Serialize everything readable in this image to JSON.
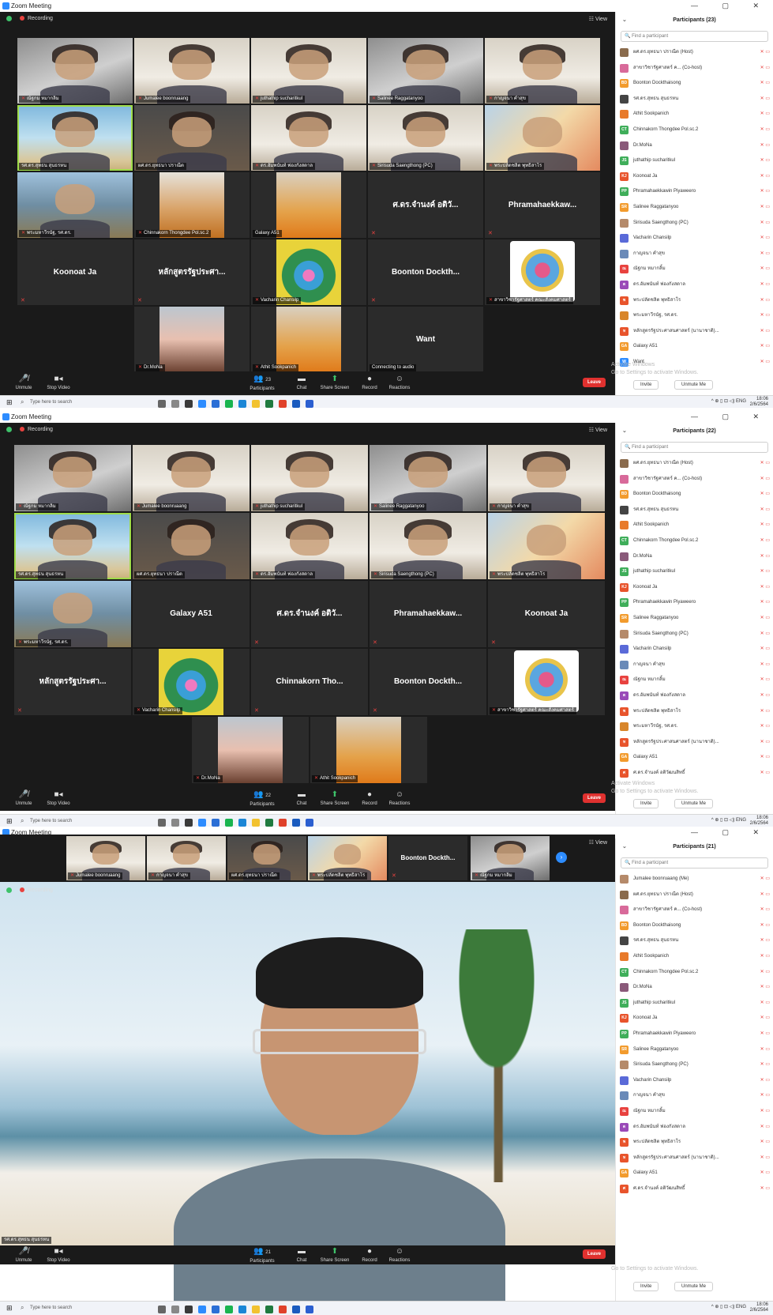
{
  "app_title": "Zoom Meeting",
  "window_controls": [
    "—",
    "▢",
    "✕"
  ],
  "recording_label": "Recording",
  "view_label": "View",
  "colors": {
    "accent": "#2d8cff",
    "leave": "#e0312f",
    "active_speaker": "#9fdc4a",
    "mic_muted": "#e8423f"
  },
  "toolbar": {
    "unmute": "Unmute",
    "stop_video": "Stop Video",
    "participants": "Participants",
    "chat": "Chat",
    "share_screen": "Share Screen",
    "record": "Record",
    "reactions": "Reactions",
    "leave": "Leave"
  },
  "taskbar": {
    "search_placeholder": "Type here to search",
    "lang": "ENG",
    "time": "18:06",
    "date": "2/6/2564"
  },
  "panel_common": {
    "search_placeholder": "Find a participant",
    "invite": "Invite",
    "unmute_me": "Unmute Me",
    "watermark_1": "Activate Windows",
    "watermark_2": "Go to Settings to activate Windows."
  },
  "shot1": {
    "participants_count_badge": "23",
    "panel_title": "Participants (23)",
    "tiles_row1": [
      "ณัฐกม หมากลิ้ม",
      "Jumalee boonruaang",
      "juthathip sucharitkul",
      "Salinee Raggatanyoo",
      "กาญจนา คำสุข"
    ],
    "tiles_row2": [
      "รศ.ดร.สุทธน สุนธรหน",
      "ผศ.ดร.ยุทธนา ปราณีต",
      "ดร.อัมพนันท์ ฟองกังสดาล",
      "Sirisuda Saengthong (PC)",
      "พระปลัดชลิต พุทธิสาโร"
    ],
    "tiles_row3": [
      "พระมหาวีรนัฐ, รศ.ดร.",
      "Chinnakorn Thongdee Pol.sc.2",
      "Galaxy A51",
      "ศ.ดร.จำนงค์ อติวั...",
      "Phramahaekkaw..."
    ],
    "tiles_row4": [
      "Koonoat Ja",
      "หลักสูตรรัฐประศา...",
      "Vacharin Chansilp",
      "Boonton Dockth...",
      "สาขาวิชารัฐศาสตร์ คณะสังคมศาสตร์"
    ],
    "tiles_row5": [
      "Dr.MoNa",
      "Athit Sookpanich",
      "Want"
    ],
    "connecting": "Connecting to audio",
    "participants": [
      {
        "name": "ผศ.ดร.ยุทธนา ปราณีต (Host)",
        "av": "",
        "c": "#8a6b4d"
      },
      {
        "name": "สาขาวิชารัฐศาสตร์ ค... (Co-host)",
        "av": "",
        "c": "#d86a9a"
      },
      {
        "name": "Boonton Dockthaisong",
        "av": "BD",
        "c": "#f29b2d"
      },
      {
        "name": "รศ.ดร.สุทธน สุนธรหน",
        "av": "",
        "c": "#444"
      },
      {
        "name": "Athit Sookpanich",
        "av": "",
        "c": "#e87a2a"
      },
      {
        "name": "Chinnakorn Thongdee Pol.sc.2",
        "av": "CT",
        "c": "#3fae5a"
      },
      {
        "name": "Dr.MoNa",
        "av": "",
        "c": "#8a5a7a"
      },
      {
        "name": "juthathip sucharitkul",
        "av": "JS",
        "c": "#3fae5a"
      },
      {
        "name": "Koonoat Ja",
        "av": "KJ",
        "c": "#e8542c"
      },
      {
        "name": "Phramahaekkawin Piyaweero",
        "av": "PP",
        "c": "#3fae5a"
      },
      {
        "name": "Salinee Raggatanyoo",
        "av": "SR",
        "c": "#f29b2d"
      },
      {
        "name": "Sirisuda Saengthong (PC)",
        "av": "",
        "c": "#b58a6a"
      },
      {
        "name": "Vacharin Chansilp",
        "av": "",
        "c": "#5a6ad8"
      },
      {
        "name": "กาญจนา คำสุข",
        "av": "",
        "c": "#6a8ab8"
      },
      {
        "name": "ณัฐกม หมากลิ้ม",
        "av": "ณ",
        "c": "#e8423f"
      },
      {
        "name": "ดร.อัมพนันท์ ฟองกังสดาล",
        "av": "ด",
        "c": "#9a4ab8"
      },
      {
        "name": "พระปลัดชลิต พุทธิสาโร",
        "av": "พ",
        "c": "#e8542c"
      },
      {
        "name": "พระมหาวีรนัฐ, รศ.ดร.",
        "av": "",
        "c": "#d8862a"
      },
      {
        "name": "หลักสูตรรัฐประศาสนศาสตร์ (นานาชาติ)...",
        "av": "ห",
        "c": "#e8542c"
      },
      {
        "name": "Galaxy A51",
        "av": "GA",
        "c": "#f29b2d"
      },
      {
        "name": "Want",
        "av": "W",
        "c": "#2d8cff"
      }
    ]
  },
  "shot2": {
    "participants_count_badge": "22",
    "panel_title": "Participants (22)",
    "tiles_row1": [
      "ณัฐกม หมากลิ้ม",
      "Jumalee boonruaang",
      "juthathip sucharitkul",
      "Salinee Raggatanyoo",
      "กาญจนา คำสุข"
    ],
    "tiles_row2": [
      "รศ.ดร.สุทธน สุนธรหน",
      "ผศ.ดร.ยุทธนา ปราณีต",
      "ดร.อัมพนันท์ ฟองกังสดาล",
      "Sirisuda Saengthong (PC)",
      "พระปลัดชลิต พุทธิสาโร"
    ],
    "tiles_row3": [
      "พระมหาวีรนัฐ, รศ.ดร.",
      "Galaxy A51",
      "ศ.ดร.จำนงค์ อติวั...",
      "Phramahaekkaw...",
      "Koonoat Ja"
    ],
    "tiles_row4": [
      "หลักสูตรรัฐประศา...",
      "Vacharin Chansilp",
      "Chinnakorn Tho...",
      "Boonton Dockth...",
      "สาขาวิชารัฐศาสตร์ คณะสังคมศาสตร์"
    ],
    "tiles_row5": [
      "Dr.MoNa",
      "Athit Sookpanich"
    ],
    "participants": [
      {
        "name": "ผศ.ดร.ยุทธนา ปราณีต (Host)",
        "av": "",
        "c": "#8a6b4d"
      },
      {
        "name": "สาขาวิชารัฐศาสตร์ ค... (Co-host)",
        "av": "",
        "c": "#d86a9a"
      },
      {
        "name": "Boonton Dockthaisong",
        "av": "BD",
        "c": "#f29b2d"
      },
      {
        "name": "รศ.ดร.สุทธน สุนธรหน",
        "av": "",
        "c": "#444"
      },
      {
        "name": "Athit Sookpanich",
        "av": "",
        "c": "#e87a2a"
      },
      {
        "name": "Chinnakorn Thongdee Pol.sc.2",
        "av": "CT",
        "c": "#3fae5a"
      },
      {
        "name": "Dr.MoNa",
        "av": "",
        "c": "#8a5a7a"
      },
      {
        "name": "juthathip sucharitkul",
        "av": "JS",
        "c": "#3fae5a"
      },
      {
        "name": "Koonoat Ja",
        "av": "KJ",
        "c": "#e8542c"
      },
      {
        "name": "Phramahaekkawin Piyaweero",
        "av": "PP",
        "c": "#3fae5a"
      },
      {
        "name": "Salinee Raggatanyoo",
        "av": "SR",
        "c": "#f29b2d"
      },
      {
        "name": "Sirisuda Saengthong (PC)",
        "av": "",
        "c": "#b58a6a"
      },
      {
        "name": "Vacharin Chansilp",
        "av": "",
        "c": "#5a6ad8"
      },
      {
        "name": "กาญจนา คำสุข",
        "av": "",
        "c": "#6a8ab8"
      },
      {
        "name": "ณัฐกม หมากลิ้ม",
        "av": "ณ",
        "c": "#e8423f"
      },
      {
        "name": "ดร.อัมพนันท์ ฟองกังสดาล",
        "av": "ด",
        "c": "#9a4ab8"
      },
      {
        "name": "พระปลัดชลิต พุทธิสาโร",
        "av": "พ",
        "c": "#e8542c"
      },
      {
        "name": "พระมหาวีรนัฐ, รศ.ดร.",
        "av": "",
        "c": "#d8862a"
      },
      {
        "name": "หลักสูตรรัฐประศาสนศาสตร์ (นานาชาติ)...",
        "av": "ห",
        "c": "#e8542c"
      },
      {
        "name": "Galaxy A51",
        "av": "GA",
        "c": "#f29b2d"
      },
      {
        "name": "ศ.ดร.จำนงค์ อติวัฒนสิทธิ์",
        "av": "ศ",
        "c": "#e8542c"
      }
    ]
  },
  "shot3": {
    "participants_count_badge": "21",
    "panel_title": "Participants (21)",
    "filmstrip": [
      "Jumalee boonruaang",
      "กาญจนา คำสุข",
      "ผศ.ดร.ยุทธนา ปราณีต",
      "พระปลัดชลิต พุทธิสาโร",
      "Boonton Dockth...",
      "ณัฐกม หมากลิ้ม"
    ],
    "speaker_name": "รศ.ดร.สุทธน สุนธรหน",
    "participants": [
      {
        "name": "Jumalee boonruaang (Me)",
        "av": "",
        "c": "#b58a6a"
      },
      {
        "name": "ผศ.ดร.ยุทธนา ปราณีต (Host)",
        "av": "",
        "c": "#8a6b4d"
      },
      {
        "name": "สาขาวิชารัฐศาสตร์ ค... (Co-host)",
        "av": "",
        "c": "#d86a9a"
      },
      {
        "name": "Boonton Dockthaisong",
        "av": "BD",
        "c": "#f29b2d"
      },
      {
        "name": "รศ.ดร.สุทธน สุนธรหน",
        "av": "",
        "c": "#444"
      },
      {
        "name": "Athit Sookpanich",
        "av": "",
        "c": "#e87a2a"
      },
      {
        "name": "Chinnakorn Thongdee Pol.sc.2",
        "av": "CT",
        "c": "#3fae5a"
      },
      {
        "name": "Dr.MoNa",
        "av": "",
        "c": "#8a5a7a"
      },
      {
        "name": "juthathip sucharitkul",
        "av": "JS",
        "c": "#3fae5a"
      },
      {
        "name": "Koonoat Ja",
        "av": "KJ",
        "c": "#e8542c"
      },
      {
        "name": "Phramahaekkawin Piyaweero",
        "av": "PP",
        "c": "#3fae5a"
      },
      {
        "name": "Salinee Raggatanyoo",
        "av": "SR",
        "c": "#f29b2d"
      },
      {
        "name": "Sirisuda Saengthong (PC)",
        "av": "",
        "c": "#b58a6a"
      },
      {
        "name": "Vacharin Chansilp",
        "av": "",
        "c": "#5a6ad8"
      },
      {
        "name": "กาญจนา คำสุข",
        "av": "",
        "c": "#6a8ab8"
      },
      {
        "name": "ณัฐกม หมากลิ้ม",
        "av": "ณ",
        "c": "#e8423f"
      },
      {
        "name": "ดร.อัมพนันท์ ฟองกังสดาล",
        "av": "ด",
        "c": "#9a4ab8"
      },
      {
        "name": "พระปลัดชลิต พุทธิสาโร",
        "av": "พ",
        "c": "#e8542c"
      },
      {
        "name": "หลักสูตรรัฐประศาสนศาสตร์ (นานาชาติ)...",
        "av": "ห",
        "c": "#e8542c"
      },
      {
        "name": "Galaxy A51",
        "av": "GA",
        "c": "#f29b2d"
      },
      {
        "name": "ศ.ดร.จำนงค์ อติวัฒนสิทธิ์",
        "av": "ศ",
        "c": "#e8542c"
      }
    ]
  }
}
